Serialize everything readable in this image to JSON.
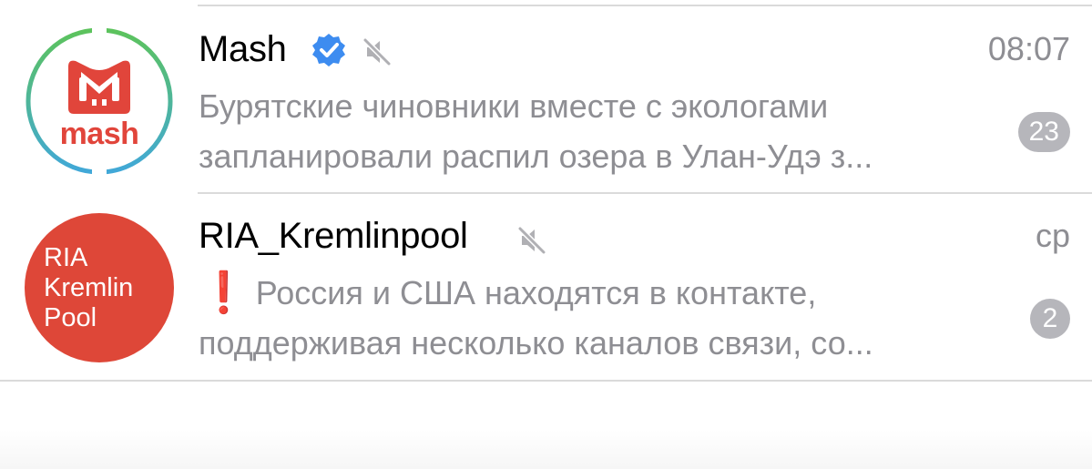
{
  "chats": [
    {
      "name": "Mash",
      "verified": true,
      "muted": true,
      "time": "08:07",
      "preview_line1": "Бурятские чиновники вместе с экологами",
      "preview_line2": "запланировали распил озера в Улан-Удэ з...",
      "unread_count": "23",
      "avatar": {
        "type": "logo",
        "logo_text": "mash",
        "logo_color": "#e1453b",
        "ring_colors": [
          "#5cc35c",
          "#41a8d8"
        ]
      }
    },
    {
      "name": "RIA_Kremlinpool",
      "verified": false,
      "muted": true,
      "time": "ср",
      "preview_emoji": "❗",
      "preview_line1": "Россия и США находятся в контакте,",
      "preview_line2": "поддерживая несколько каналов связи, со...",
      "unread_count": "2",
      "avatar": {
        "type": "text",
        "lines": [
          "RIA",
          "Kremlin",
          "Pool"
        ],
        "background": "#de4738"
      }
    }
  ],
  "colors": {
    "secondary_text": "#8e8e93",
    "badge_muted": "#b6b6bb",
    "verified_blue": "#3d8cf0",
    "divider": "#dadada"
  },
  "icons": {
    "verified": "verified-badge-icon",
    "muted": "muted-speaker-icon"
  }
}
